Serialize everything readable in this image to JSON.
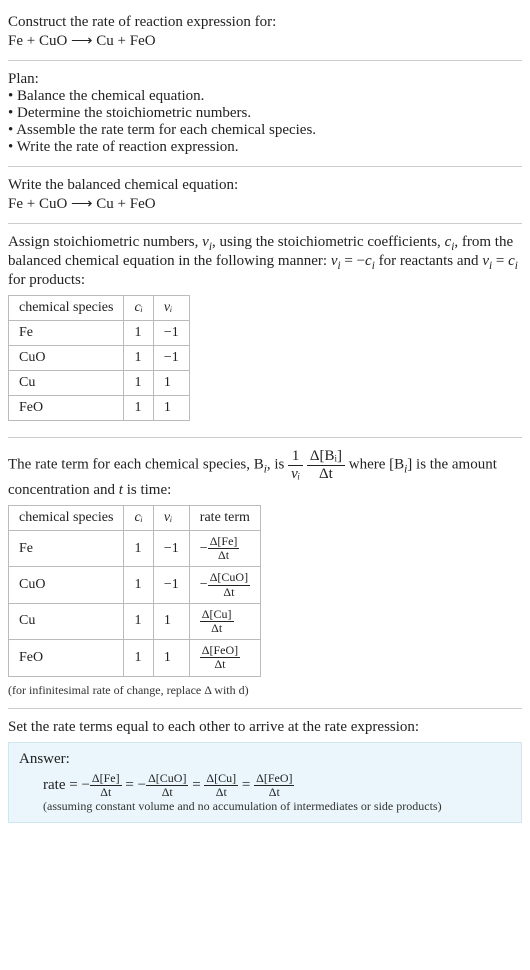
{
  "intro": {
    "prompt": "Construct the rate of reaction expression for:",
    "equation": "Fe + CuO  ⟶  Cu + FeO"
  },
  "plan": {
    "heading": "Plan:",
    "items": [
      "Balance the chemical equation.",
      "Determine the stoichiometric numbers.",
      "Assemble the rate term for each chemical species.",
      "Write the rate of reaction expression."
    ]
  },
  "balanced": {
    "heading": "Write the balanced chemical equation:",
    "equation": "Fe + CuO  ⟶  Cu + FeO"
  },
  "stoich": {
    "intro_a": "Assign stoichiometric numbers, ",
    "nu_i": "ν",
    "intro_b": ", using the stoichiometric coefficients, ",
    "c_i": "c",
    "intro_c": ", from the balanced chemical equation in the following manner: ",
    "rule1": " = −",
    "rule1b": " for reactants and ",
    "rule2": " = ",
    "rule2b": " for products:",
    "headers": [
      "chemical species",
      "cᵢ",
      "νᵢ"
    ],
    "rows": [
      [
        "Fe",
        "1",
        "−1"
      ],
      [
        "CuO",
        "1",
        "−1"
      ],
      [
        "Cu",
        "1",
        "1"
      ],
      [
        "FeO",
        "1",
        "1"
      ]
    ]
  },
  "rateterm": {
    "intro_a": "The rate term for each chemical species, B",
    "intro_b": ", is ",
    "frac1_num": "1",
    "frac1_den": "νᵢ",
    "frac2_num": "Δ[Bᵢ]",
    "frac2_den": "Δt",
    "intro_c": " where [B",
    "intro_d": "] is the amount concentration and ",
    "t": "t",
    "intro_e": " is time:",
    "headers": [
      "chemical species",
      "cᵢ",
      "νᵢ",
      "rate term"
    ],
    "rows": [
      {
        "sp": "Fe",
        "c": "1",
        "nu": "−1",
        "sign": "−",
        "num": "Δ[Fe]",
        "den": "Δt"
      },
      {
        "sp": "CuO",
        "c": "1",
        "nu": "−1",
        "sign": "−",
        "num": "Δ[CuO]",
        "den": "Δt"
      },
      {
        "sp": "Cu",
        "c": "1",
        "nu": "1",
        "sign": "",
        "num": "Δ[Cu]",
        "den": "Δt"
      },
      {
        "sp": "FeO",
        "c": "1",
        "nu": "1",
        "sign": "",
        "num": "Δ[FeO]",
        "den": "Δt"
      }
    ],
    "note": "(for infinitesimal rate of change, replace Δ with d)"
  },
  "final": {
    "heading": "Set the rate terms equal to each other to arrive at the rate expression:",
    "answer_label": "Answer:",
    "rate_label": "rate = ",
    "terms": [
      {
        "sign": "−",
        "num": "Δ[Fe]",
        "den": "Δt"
      },
      {
        "sign": "−",
        "num": "Δ[CuO]",
        "den": "Δt"
      },
      {
        "sign": "",
        "num": "Δ[Cu]",
        "den": "Δt"
      },
      {
        "sign": "",
        "num": "Δ[FeO]",
        "den": "Δt"
      }
    ],
    "eq": " = ",
    "note": "(assuming constant volume and no accumulation of intermediates or side products)"
  }
}
